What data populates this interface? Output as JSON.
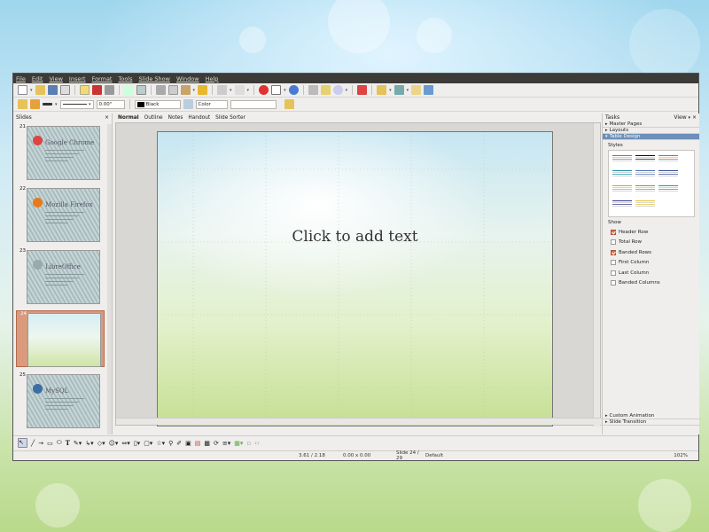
{
  "menu": [
    "File",
    "Edit",
    "View",
    "Insert",
    "Format",
    "Tools",
    "Slide Show",
    "Window",
    "Help"
  ],
  "toolbar2": {
    "line_width": "0.00\"",
    "line_color": "Black",
    "area_style": "Color"
  },
  "slides_pane": {
    "title": "Slides",
    "close": "×",
    "slides": [
      {
        "num": "21",
        "title": "Google Chrome",
        "logo": "chrome-logo",
        "logo_color": "#d44"
      },
      {
        "num": "22",
        "title": "Mozilla Firefox",
        "logo": "firefox-logo",
        "logo_color": "#e87a1c"
      },
      {
        "num": "23",
        "title": "LibreOffice",
        "logo": "libreoffice-logo",
        "logo_color": "#9aa"
      },
      {
        "num": "24",
        "title": "",
        "logo": "",
        "logo_color": ""
      },
      {
        "num": "25",
        "title": "MySQL",
        "logo": "mysql-logo",
        "logo_color": "#3b6ea5"
      }
    ],
    "selected": "24"
  },
  "view_tabs": [
    "Normal",
    "Outline",
    "Notes",
    "Handout",
    "Slide Sorter"
  ],
  "active_view_tab": "Normal",
  "slide": {
    "placeholder": "Click to add text"
  },
  "tasks": {
    "title": "Tasks",
    "view_menu": "View",
    "close": "×",
    "sections": [
      {
        "label": "Master Pages",
        "expanded": false
      },
      {
        "label": "Layouts",
        "expanded": false
      },
      {
        "label": "Table Design",
        "expanded": true
      }
    ],
    "styles_label": "Styles",
    "show_label": "Show",
    "options": [
      {
        "label": "Header Row",
        "checked": true
      },
      {
        "label": "Total Row",
        "checked": false
      },
      {
        "label": "Banded Rows",
        "checked": true
      },
      {
        "label": "First Column",
        "checked": false
      },
      {
        "label": "Last Column",
        "checked": false
      },
      {
        "label": "Banded Columns",
        "checked": false
      }
    ],
    "bottom_sections": [
      "Custom Animation",
      "Slide Transition"
    ],
    "style_colors": [
      "#7a7a7a",
      "#111111",
      "#d95b2a",
      "#ffffff",
      "#1e8fa8",
      "#4a6fb5",
      "#3a4d9a",
      "#ffffff",
      "#e59a2e",
      "#7aa33a",
      "#1fa0a0",
      "#ffffff",
      "#3a3a8a",
      "#e8c23a",
      "#ffffff",
      "#ffffff"
    ]
  },
  "status": {
    "position": "3.61 / 2.18",
    "size": "0.00 x 0.00",
    "slide_info": "Slide 24 / 29",
    "master": "Default",
    "zoom": "102%"
  },
  "colors": {
    "titlebar": "#3c3b37",
    "selection": "#6d8fb8",
    "accent": "#e0704a"
  }
}
